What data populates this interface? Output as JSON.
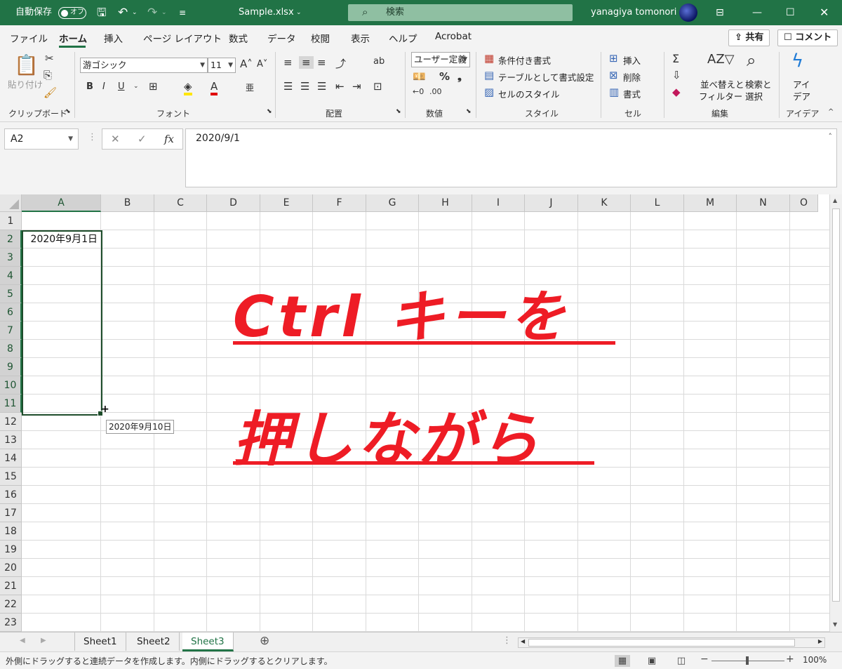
{
  "titlebar": {
    "autosave_label": "自動保存",
    "autosave_state": "オフ",
    "filename": "Sample.xlsx",
    "search_placeholder": "検索",
    "user": "yanagiya tomonori"
  },
  "tabs": [
    "ファイル",
    "ホーム",
    "挿入",
    "ページ レイアウト",
    "数式",
    "データ",
    "校閲",
    "表示",
    "ヘルプ",
    "Acrobat"
  ],
  "share_label": "共有",
  "comment_label": "コメント",
  "ribbon": {
    "clipboard": {
      "paste": "貼り付け",
      "group": "クリップボード"
    },
    "font": {
      "name": "游ゴシック",
      "size": "11",
      "group": "フォント"
    },
    "alignment": {
      "group": "配置"
    },
    "number": {
      "format": "ユーザー定義",
      "group": "数値"
    },
    "styles": {
      "conditional": "条件付き書式",
      "table": "テーブルとして書式設定",
      "cell_styles": "セルのスタイル",
      "group": "スタイル"
    },
    "cells": {
      "insert": "挿入",
      "delete": "削除",
      "format": "書式",
      "group": "セル"
    },
    "editing": {
      "sort_line1": "並べ替えと",
      "sort_line2": "フィルター",
      "find_line1": "検索と",
      "find_line2": "選択",
      "group": "編集"
    },
    "ideas": {
      "line1": "アイ",
      "line2": "デア",
      "group": "アイデア"
    }
  },
  "formula_bar": {
    "name_box": "A2",
    "formula": "2020/9/1"
  },
  "grid": {
    "columns": [
      "A",
      "B",
      "C",
      "D",
      "E",
      "F",
      "G",
      "H",
      "I",
      "J",
      "K",
      "L",
      "M",
      "N",
      "O"
    ],
    "rows": [
      "1",
      "2",
      "3",
      "4",
      "5",
      "6",
      "7",
      "8",
      "9",
      "10",
      "11",
      "12",
      "13",
      "14",
      "15",
      "16",
      "17",
      "18",
      "19",
      "20",
      "21",
      "22",
      "23"
    ],
    "selected_column": "A",
    "selected_rows": [
      "2",
      "3",
      "4",
      "5",
      "6",
      "7",
      "8",
      "9",
      "10",
      "11"
    ],
    "cell_A2": "2020年9月1日",
    "fill_tooltip": "2020年9月10日"
  },
  "overlay": {
    "line1": "Ctrl キーを",
    "line2": "押しながら",
    "color": "#ee1c25"
  },
  "sheets": [
    "Sheet1",
    "Sheet2",
    "Sheet3"
  ],
  "active_sheet": "Sheet3",
  "status": {
    "message": "外側にドラッグすると連続データを作成します。内側にドラッグするとクリアします。",
    "zoom": "100%"
  },
  "colors": {
    "accent": "#217346",
    "selection_border": "#1e4d2b"
  }
}
